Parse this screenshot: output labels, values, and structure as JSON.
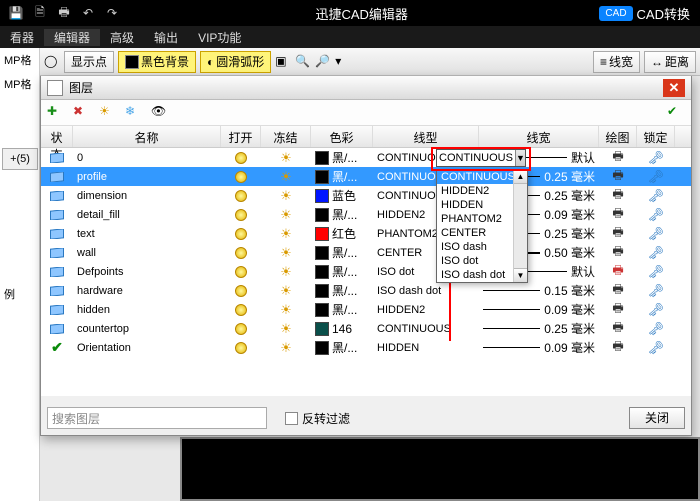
{
  "titlebar": {
    "app_title": "迅捷CAD编辑器",
    "cad_badge": "CAD",
    "convert": "CAD转换"
  },
  "menu": {
    "viewer": "看器",
    "editor": "编辑器",
    "advanced": "高级",
    "output": "输出",
    "vip": "VIP功能"
  },
  "toolbar2": {
    "show_point": "显示点",
    "black_bg": "黑色背景",
    "smooth_arc": "圆滑弧形",
    "lineweight": "线宽",
    "distance": "距离"
  },
  "leftpanel": {
    "mp1": "MP格",
    "mp2": "MP格",
    "plus": "+(5)",
    "example": "例"
  },
  "layers_window": {
    "title": "图层",
    "search_placeholder": "搜索图层",
    "reverse_filter": "反转过滤",
    "close": "关闭"
  },
  "columns": {
    "state": "状态",
    "name": "名称",
    "open": "打开",
    "freeze": "冻结",
    "color": "色彩",
    "ltype": "线型",
    "lweight": "线宽",
    "plot": "绘图",
    "lock": "锁定"
  },
  "rows": [
    {
      "state": "diamond",
      "name": "0",
      "color_sw": "#000",
      "color_txt": "黑/...",
      "ltype": "CONTINUOUS",
      "lw": "默认",
      "lw_cls": "",
      "plot": true
    },
    {
      "state": "diamond",
      "name": "profile",
      "color_sw": "#000",
      "color_txt": "黑/...",
      "ltype": "CONTINUOUS",
      "lw": "0.25 毫米",
      "lw_cls": "",
      "plot": true,
      "selected": true
    },
    {
      "state": "diamond",
      "name": "dimension",
      "color_sw": "#0015ff",
      "color_txt": "蓝色",
      "ltype": "CONTINUOUS",
      "lw": "0.25 毫米",
      "lw_cls": "",
      "plot": true
    },
    {
      "state": "diamond",
      "name": "detail_fill",
      "color_sw": "#000",
      "color_txt": "黑/...",
      "ltype": "HIDDEN2",
      "lw": "0.09 毫米",
      "lw_cls": "",
      "plot": true
    },
    {
      "state": "diamond",
      "name": "text",
      "color_sw": "#ff0000",
      "color_txt": "红色",
      "ltype": "PHANTOM2",
      "lw": "0.25 毫米",
      "lw_cls": "",
      "plot": true
    },
    {
      "state": "diamond",
      "name": "wall",
      "color_sw": "#000",
      "color_txt": "黑/...",
      "ltype": "CENTER",
      "lw": "0.50 毫米",
      "lw_cls": "b05",
      "plot": true
    },
    {
      "state": "diamond",
      "name": "Defpoints",
      "color_sw": "#000",
      "color_txt": "黑/...",
      "ltype": "ISO dot",
      "lw": "默认",
      "lw_cls": "",
      "plot": false
    },
    {
      "state": "diamond",
      "name": "hardware",
      "color_sw": "#000",
      "color_txt": "黑/...",
      "ltype": "ISO dash dot",
      "lw": "0.15 毫米",
      "lw_cls": "",
      "plot": true
    },
    {
      "state": "diamond",
      "name": "hidden",
      "color_sw": "#000",
      "color_txt": "黑/...",
      "ltype": "HIDDEN2",
      "lw": "0.09 毫米",
      "lw_cls": "",
      "plot": true
    },
    {
      "state": "diamond",
      "name": "countertop",
      "color_sw": "#0a4f4a",
      "color_txt": "146",
      "ltype": "CONTINUOUS",
      "lw": "0.25 毫米",
      "lw_cls": "",
      "plot": true
    },
    {
      "state": "check",
      "name": "Orientation",
      "color_sw": "#000",
      "color_txt": "黑/...",
      "ltype": "HIDDEN",
      "lw": "0.09 毫米",
      "lw_cls": "",
      "plot": true
    }
  ],
  "combo_value": "CONTINUOUS",
  "dropdown": [
    "CONTINUOUS",
    "HIDDEN2",
    "HIDDEN",
    "PHANTOM2",
    "CENTER",
    "ISO dash",
    "ISO dot",
    "ISO dash dot"
  ]
}
